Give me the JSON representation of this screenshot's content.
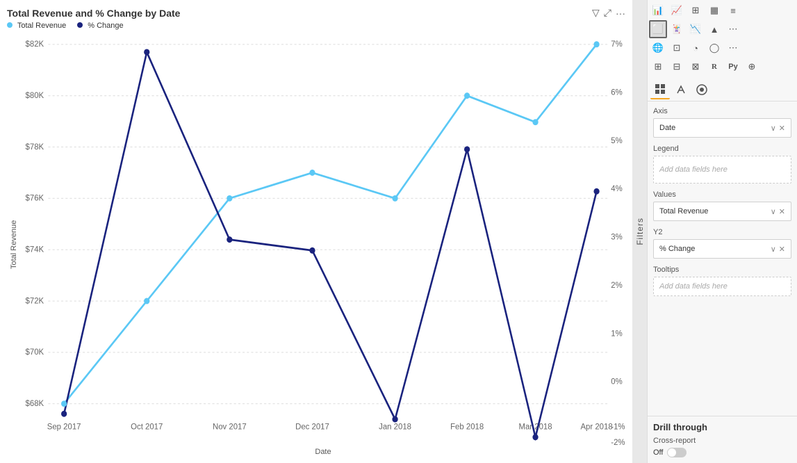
{
  "chart": {
    "title": "Total Revenue and % Change by Date",
    "legend": [
      {
        "label": "Total Revenue",
        "color": "#5bc8f5"
      },
      {
        "label": "% Change",
        "color": "#1a237e"
      }
    ],
    "yAxisLabel": "Total Revenue",
    "xAxisLabel": "Date",
    "xLabels": [
      "Sep 2017",
      "Oct 2017",
      "Nov 2017",
      "Dec 2017",
      "Jan 2018",
      "Feb 2018",
      "Mar 2018",
      "Apr 2018"
    ],
    "yLabels": [
      "$82K",
      "$80K",
      "$78K",
      "$76K",
      "$74K",
      "$72K",
      "$70K",
      "$68K"
    ],
    "y2Labels": [
      "7%",
      "6%",
      "5%",
      "4%",
      "3%",
      "2%",
      "1%",
      "0%",
      "-1%",
      "-2%"
    ],
    "icons": {
      "filter": "▽",
      "expand": "⤢",
      "more": "···"
    }
  },
  "rightPanel": {
    "filters_label": "Filters",
    "axis_label": "Axis",
    "axis_field": "Date",
    "legend_label": "Legend",
    "legend_placeholder": "Add data fields here",
    "values_label": "Values",
    "values_field": "Total Revenue",
    "y2_label": "Y2",
    "y2_field": "% Change",
    "tooltips_label": "Tooltips",
    "tooltips_placeholder": "Add data fields here",
    "drill_title": "Drill through",
    "cross_report_label": "Cross-report",
    "toggle_label": "Off"
  }
}
